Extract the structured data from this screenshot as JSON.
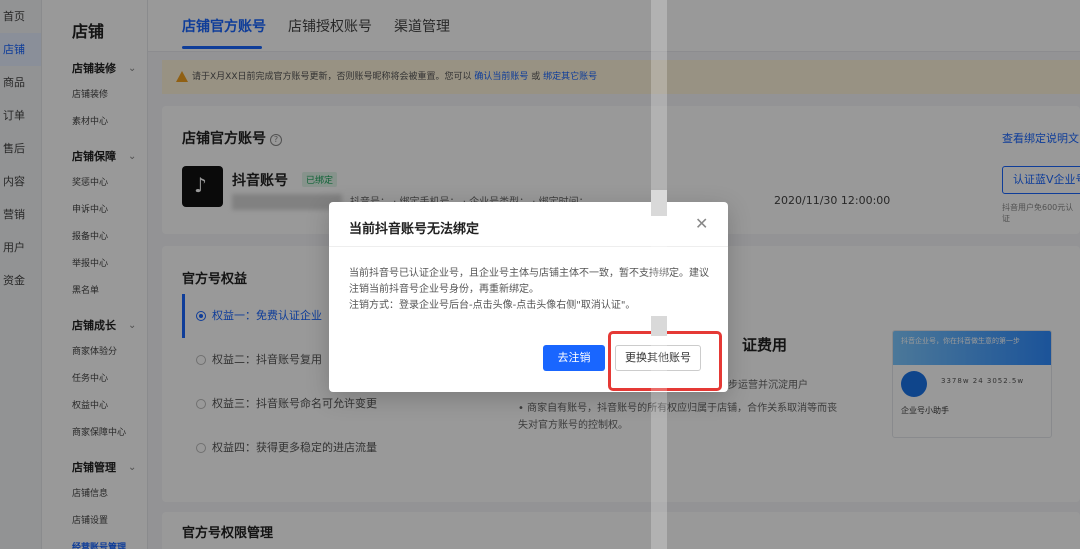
{
  "nav": [
    "首页",
    "店铺",
    "商品",
    "订单",
    "售后",
    "内容",
    "营销",
    "用户",
    "资金"
  ],
  "subnav": {
    "title": "店铺",
    "groups": [
      {
        "label": "店铺装修",
        "items": [
          "店铺装修",
          "素材中心"
        ]
      },
      {
        "label": "店铺保障",
        "items": [
          "奖惩中心",
          "申诉中心",
          "报备中心",
          "举报中心",
          "黑名单"
        ]
      },
      {
        "label": "店铺成长",
        "items": [
          "商家体验分",
          "任务中心",
          "权益中心",
          "商家保障中心"
        ]
      },
      {
        "label": "店铺管理",
        "items": [
          "店铺信息",
          "店铺设置",
          "经营账号管理"
        ]
      }
    ]
  },
  "tabs": [
    "店铺官方账号",
    "店铺授权账号",
    "渠道管理"
  ],
  "notice": {
    "text": "请于X月XX日前完成官方账号更新，否则账号昵称将会被重置。您可以",
    "link1": "确认当前账号",
    "mid": "或",
    "link2": "绑定其它账号"
  },
  "account": {
    "section_title": "店铺官方账号",
    "view_link": "查看绑定说明文",
    "name": "抖音账号",
    "badge": "已绑定",
    "meta": "抖音号：  · 绑定手机号：  · 企业号类型：  ·  绑定时间：",
    "bind_time": "2020/11/30 12:00:00",
    "verify_btn": "认证蓝V企业号",
    "verify_note": "抖音用户免600元认证"
  },
  "rights": {
    "title": "官方号权益",
    "items": [
      "权益一：免费认证企业",
      "权益二：抖音账号复用",
      "权益三：抖音账号命名可允许变更",
      "权益四：获得更多稳定的进店流量"
    ],
    "fee_title": "证费用",
    "fee_desc1": "同步运营并沉淀用户",
    "fee_desc2": "• 商家自有账号，抖音账号的所有权应归属于店铺，合作关系取消等而丧失对官方账号的控制权。",
    "promo": {
      "top": "抖音企业号，你在抖音做生意的第一步",
      "name": "企业号小助手",
      "stats": "3378w   24   3052.5w"
    }
  },
  "perm_title": "官方号权限管理",
  "modal": {
    "title": "当前抖音账号无法绑定",
    "body1": "当前抖音号已认证企业号，且企业号主体与店铺主体不一致，暂不支持绑定。建议注销当前抖音号企业号身份，再重新绑定。",
    "body2": "注销方式：登录企业号后台-点击头像-点击头像右侧\"取消认证\"。",
    "primary": "去注销",
    "secondary": "更换其他账号"
  }
}
